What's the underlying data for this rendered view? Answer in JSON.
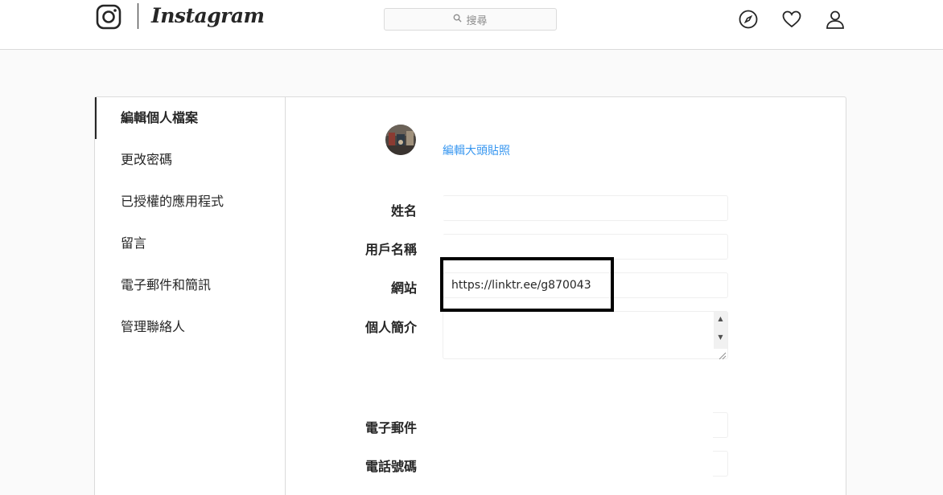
{
  "header": {
    "wordmark": "Instagram",
    "search_placeholder": "搜尋",
    "icons": [
      "instagram-glyph-icon",
      "search-icon",
      "compass-icon",
      "heart-icon",
      "profile-icon"
    ]
  },
  "sidebar": {
    "items": [
      {
        "label": "編輯個人檔案",
        "active": true
      },
      {
        "label": "更改密碼",
        "active": false
      },
      {
        "label": "已授權的應用程式",
        "active": false
      },
      {
        "label": "留言",
        "active": false
      },
      {
        "label": "電子郵件和簡訊",
        "active": false
      },
      {
        "label": "管理聯絡人",
        "active": false
      }
    ]
  },
  "form": {
    "change_photo_label": "編輯大頭貼照",
    "fields": {
      "name": {
        "label": "姓名",
        "value": ""
      },
      "username": {
        "label": "用戶名稱",
        "value": ""
      },
      "website": {
        "label": "網站",
        "value": "https://linktr.ee/g870043"
      },
      "bio": {
        "label": "個人簡介",
        "value": ""
      },
      "email": {
        "label": "電子郵件",
        "value": ""
      },
      "phone": {
        "label": "電話號碼",
        "value": ""
      }
    }
  },
  "colors": {
    "link": "#3897f0",
    "border": "#dbdbdb",
    "text": "#262626",
    "highlight": "#000000"
  }
}
